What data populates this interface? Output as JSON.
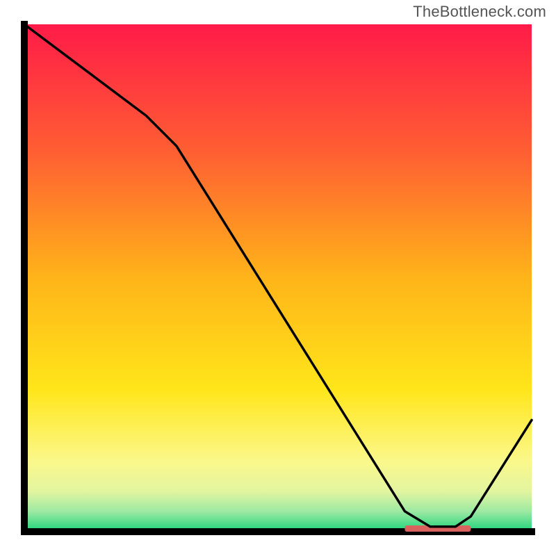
{
  "watermark": "TheBottleneck.com",
  "chart_data": {
    "type": "line",
    "title": "",
    "xlabel": "",
    "ylabel": "",
    "xlim": [
      0,
      100
    ],
    "ylim": [
      0,
      100
    ],
    "x": [
      0,
      8,
      24,
      30,
      65,
      75,
      80,
      85,
      88,
      100
    ],
    "values": [
      100,
      94,
      82,
      76,
      20,
      4,
      1,
      1,
      3,
      22
    ],
    "marker_range_x": [
      75,
      88
    ],
    "background_gradient": [
      {
        "pos": 0.0,
        "color": "#ff1b48"
      },
      {
        "pos": 0.25,
        "color": "#ff5e33"
      },
      {
        "pos": 0.5,
        "color": "#ffb419"
      },
      {
        "pos": 0.72,
        "color": "#ffe61a"
      },
      {
        "pos": 0.86,
        "color": "#fbf88a"
      },
      {
        "pos": 0.92,
        "color": "#e3f5a0"
      },
      {
        "pos": 0.96,
        "color": "#9de9a3"
      },
      {
        "pos": 1.0,
        "color": "#1bd47a"
      }
    ]
  }
}
